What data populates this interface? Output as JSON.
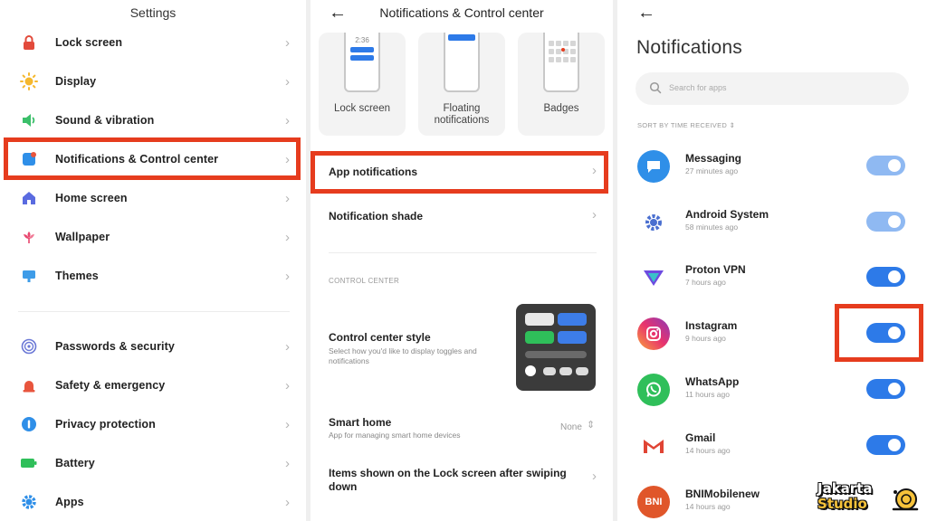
{
  "settings": {
    "title": "Settings",
    "items": [
      {
        "label": "Lock screen",
        "icon": "lock-icon",
        "color": "#e24a3b"
      },
      {
        "label": "Display",
        "icon": "sun-icon",
        "color": "#f5b82e"
      },
      {
        "label": "Sound & vibration",
        "icon": "speaker-icon",
        "color": "#3bbf6a"
      },
      {
        "label": "Notifications & Control center",
        "icon": "notification-icon",
        "color": "#2f8fe8"
      },
      {
        "label": "Home screen",
        "icon": "home-icon",
        "color": "#5a6be0"
      },
      {
        "label": "Wallpaper",
        "icon": "flower-icon",
        "color": "#e8466e"
      },
      {
        "label": "Themes",
        "icon": "themes-icon",
        "color": "#3e9ce8"
      },
      {
        "label": "Passwords & security",
        "icon": "fingerprint-icon",
        "color": "#6b78d6"
      },
      {
        "label": "Safety & emergency",
        "icon": "emergency-icon",
        "color": "#e8553d"
      },
      {
        "label": "Privacy protection",
        "icon": "privacy-icon",
        "color": "#2f8fe8"
      },
      {
        "label": "Battery",
        "icon": "battery-icon",
        "color": "#2fbf5a"
      },
      {
        "label": "Apps",
        "icon": "gear-icon",
        "color": "#2f8fe8"
      }
    ]
  },
  "notif_cc": {
    "title": "Notifications & Control center",
    "cards": [
      "Lock screen",
      "Floating notifications",
      "Badges"
    ],
    "lock_time": "2:36",
    "app_notifications": "App notifications",
    "notification_shade": "Notification shade",
    "section_control_center": "CONTROL CENTER",
    "cc_style_title": "Control center style",
    "cc_style_sub": "Select how you'd like to display toggles and notifications",
    "smart_home_title": "Smart home",
    "smart_home_sub": "App for managing smart home devices",
    "smart_home_value": "None",
    "lock_items_title": "Items shown on the Lock screen after swiping down"
  },
  "notifications": {
    "title": "Notifications",
    "search_placeholder": "Search for apps",
    "sort_label": "SORT BY TIME RECEIVED",
    "apps": [
      {
        "name": "Messaging",
        "time": "27 minutes ago",
        "icon": "messaging-icon",
        "enabled": true,
        "dim": true
      },
      {
        "name": "Android System",
        "time": "58 minutes ago",
        "icon": "android-system-icon",
        "enabled": true,
        "dim": true
      },
      {
        "name": "Proton VPN",
        "time": "7 hours ago",
        "icon": "proton-vpn-icon",
        "enabled": true,
        "dim": false
      },
      {
        "name": "Instagram",
        "time": "9 hours ago",
        "icon": "instagram-icon",
        "enabled": true,
        "dim": false
      },
      {
        "name": "WhatsApp",
        "time": "11 hours ago",
        "icon": "whatsapp-icon",
        "enabled": true,
        "dim": false
      },
      {
        "name": "Gmail",
        "time": "14 hours ago",
        "icon": "gmail-icon",
        "enabled": true,
        "dim": false
      },
      {
        "name": "BNIMobilenew",
        "time": "14 hours ago",
        "icon": "bni-icon",
        "enabled": true,
        "dim": false
      }
    ],
    "bni_icon_text": "BNI",
    "toggle_on_color": "#2d7ae8",
    "toggle_dim_color": "#8fb9f2"
  },
  "highlight_color": "#e63c1e",
  "watermark": {
    "line1": "Jakarta",
    "line2": "Studio"
  }
}
